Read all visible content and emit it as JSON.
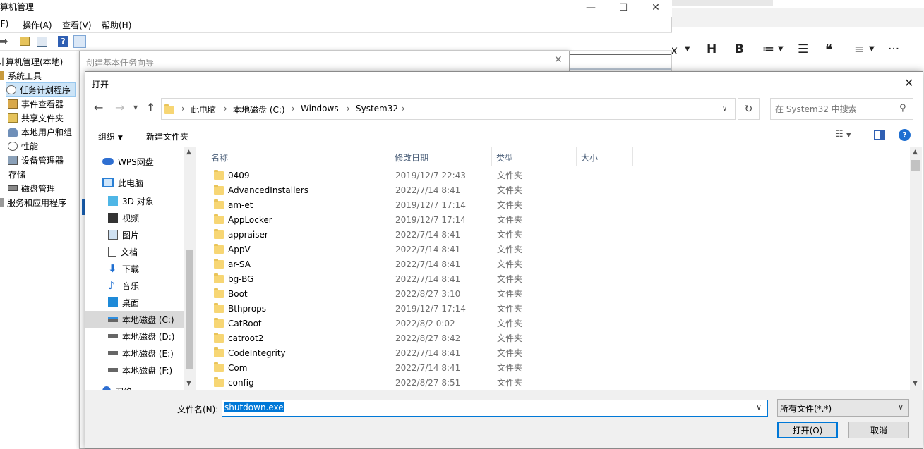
{
  "mmc": {
    "title": "计算机管理",
    "menu": [
      "文件(F)",
      "操作(A)",
      "查看(V)",
      "帮助(H)"
    ],
    "menu_display": [
      "(F)",
      "操作(A)",
      "查看(V)",
      "帮助(H)"
    ],
    "tree": [
      {
        "label": "计算机管理(本地)",
        "indent": 0
      },
      {
        "label": "系统工具",
        "indent": 1
      },
      {
        "label": "任务计划程序",
        "indent": 2,
        "selected": true
      },
      {
        "label": "事件查看器",
        "indent": 2
      },
      {
        "label": "共享文件夹",
        "indent": 2
      },
      {
        "label": "本地用户和组",
        "indent": 2
      },
      {
        "label": "性能",
        "indent": 2
      },
      {
        "label": "设备管理器",
        "indent": 2
      },
      {
        "label": "存储",
        "indent": 1
      },
      {
        "label": "磁盘管理",
        "indent": 2
      },
      {
        "label": "服务和应用程序",
        "indent": 1
      }
    ]
  },
  "wizard": {
    "title": "创建基本任务向导"
  },
  "editor_toolbar": [
    "x",
    "H",
    "B",
    "≔",
    "☰",
    "❝",
    "≡",
    "···"
  ],
  "dialog": {
    "title": "打开",
    "breadcrumb": [
      "此电脑",
      "本地磁盘 (C:)",
      "Windows",
      "System32"
    ],
    "search_placeholder": "在 System32 中搜索",
    "organize": "组织",
    "new_folder": "新建文件夹",
    "nav": [
      {
        "label": "WPS网盘",
        "icon": "cloud-icon"
      },
      {
        "label": "此电脑",
        "icon": "computer-icon"
      },
      {
        "label": "3D 对象",
        "icon": "cube-icon"
      },
      {
        "label": "视频",
        "icon": "video-icon"
      },
      {
        "label": "图片",
        "icon": "picture-icon"
      },
      {
        "label": "文档",
        "icon": "document-icon"
      },
      {
        "label": "下载",
        "icon": "download-icon"
      },
      {
        "label": "音乐",
        "icon": "music-icon"
      },
      {
        "label": "桌面",
        "icon": "desktop-icon"
      },
      {
        "label": "本地磁盘 (C:)",
        "icon": "drive-icon",
        "selected": true
      },
      {
        "label": "本地磁盘 (D:)",
        "icon": "drive-icon"
      },
      {
        "label": "本地磁盘 (E:)",
        "icon": "drive-icon"
      },
      {
        "label": "本地磁盘 (F:)",
        "icon": "drive-icon"
      },
      {
        "label": "网络",
        "icon": "network-icon"
      }
    ],
    "columns": {
      "name": "名称",
      "date": "修改日期",
      "type": "类型",
      "size": "大小"
    },
    "files": [
      {
        "name": "0409",
        "date": "2019/12/7 22:43",
        "type": "文件夹"
      },
      {
        "name": "AdvancedInstallers",
        "date": "2022/7/14 8:41",
        "type": "文件夹"
      },
      {
        "name": "am-et",
        "date": "2019/12/7 17:14",
        "type": "文件夹"
      },
      {
        "name": "AppLocker",
        "date": "2019/12/7 17:14",
        "type": "文件夹"
      },
      {
        "name": "appraiser",
        "date": "2022/7/14 8:41",
        "type": "文件夹"
      },
      {
        "name": "AppV",
        "date": "2022/7/14 8:41",
        "type": "文件夹"
      },
      {
        "name": "ar-SA",
        "date": "2022/7/14 8:41",
        "type": "文件夹"
      },
      {
        "name": "bg-BG",
        "date": "2022/7/14 8:41",
        "type": "文件夹"
      },
      {
        "name": "Boot",
        "date": "2022/8/27 3:10",
        "type": "文件夹"
      },
      {
        "name": "Bthprops",
        "date": "2019/12/7 17:14",
        "type": "文件夹"
      },
      {
        "name": "CatRoot",
        "date": "2022/8/2 0:02",
        "type": "文件夹"
      },
      {
        "name": "catroot2",
        "date": "2022/8/27 8:42",
        "type": "文件夹"
      },
      {
        "name": "CodeIntegrity",
        "date": "2022/7/14 8:41",
        "type": "文件夹"
      },
      {
        "name": "Com",
        "date": "2022/7/14 8:41",
        "type": "文件夹"
      },
      {
        "name": "config",
        "date": "2022/8/27 8:51",
        "type": "文件夹"
      }
    ],
    "filename_label": "文件名(N):",
    "filename_value": "shutdown.exe",
    "filetype": "所有文件(*.*)",
    "open_button": "打开(O)",
    "cancel_button": "取消"
  }
}
